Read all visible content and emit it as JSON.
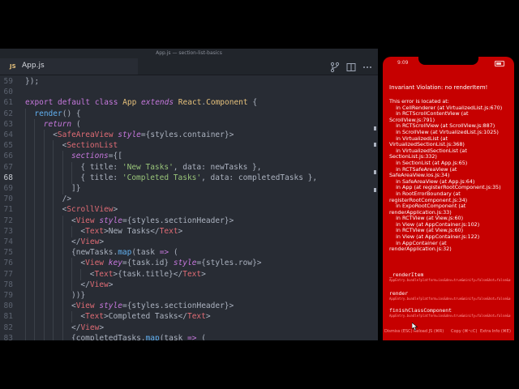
{
  "editor": {
    "window_title": "App.js — section-list-basics",
    "tab": {
      "lang_badge": "JS",
      "filename": "App.js"
    },
    "toolbar_icons": [
      "source-control-icon",
      "split-editor-icon",
      "more-actions-icon"
    ],
    "lines": [
      {
        "num": "59",
        "indent": 0,
        "tokens": [
          {
            "t": "});",
            "c": "br"
          }
        ]
      },
      {
        "num": "60",
        "indent": 0,
        "tokens": []
      },
      {
        "num": "61",
        "indent": 0,
        "tokens": [
          {
            "t": "export ",
            "c": "kw"
          },
          {
            "t": "default ",
            "c": "kw"
          },
          {
            "t": "class ",
            "c": "kw"
          },
          {
            "t": "App ",
            "c": "cls"
          },
          {
            "t": "extends ",
            "c": "kw ital"
          },
          {
            "t": "React",
            "c": "cls"
          },
          {
            "t": ".",
            "c": "br"
          },
          {
            "t": "Component",
            "c": "cls"
          },
          {
            "t": " {",
            "c": "br"
          }
        ]
      },
      {
        "num": "62",
        "indent": 1,
        "tokens": [
          {
            "t": "render",
            "c": "fn"
          },
          {
            "t": "() {",
            "c": "br"
          }
        ]
      },
      {
        "num": "63",
        "indent": 2,
        "tokens": [
          {
            "t": "return",
            "c": "kw ital"
          },
          {
            "t": " (",
            "c": "br"
          }
        ]
      },
      {
        "num": "64",
        "indent": 3,
        "tokens": [
          {
            "t": "<",
            "c": "br"
          },
          {
            "t": "SafeAreaView",
            "c": "tag"
          },
          {
            "t": " ",
            "c": "br"
          },
          {
            "t": "style",
            "c": "attr ital"
          },
          {
            "t": "={styles.container}>",
            "c": "br"
          }
        ]
      },
      {
        "num": "65",
        "indent": 4,
        "tokens": [
          {
            "t": "<",
            "c": "br"
          },
          {
            "t": "SectionList",
            "c": "tag"
          }
        ]
      },
      {
        "num": "66",
        "indent": 5,
        "tokens": [
          {
            "t": "sections",
            "c": "attr ital"
          },
          {
            "t": "={[",
            "c": "br"
          }
        ]
      },
      {
        "num": "67",
        "indent": 6,
        "tokens": [
          {
            "t": "{ title: ",
            "c": "prop"
          },
          {
            "t": "'New Tasks'",
            "c": "str"
          },
          {
            "t": ", data: newTasks },",
            "c": "prop"
          }
        ]
      },
      {
        "num": "68",
        "indent": 6,
        "active": true,
        "tokens": [
          {
            "t": "{ title: ",
            "c": "prop"
          },
          {
            "t": "'Completed Tasks'",
            "c": "str"
          },
          {
            "t": ", data: completedTasks },",
            "c": "prop"
          }
        ]
      },
      {
        "num": "69",
        "indent": 5,
        "tokens": [
          {
            "t": "]}",
            "c": "br"
          }
        ]
      },
      {
        "num": "70",
        "indent": 4,
        "tokens": [
          {
            "t": "/>",
            "c": "br"
          }
        ]
      },
      {
        "num": "71",
        "indent": 4,
        "tokens": [
          {
            "t": "<",
            "c": "br"
          },
          {
            "t": "ScrollView",
            "c": "tag"
          },
          {
            "t": ">",
            "c": "br"
          }
        ]
      },
      {
        "num": "72",
        "indent": 5,
        "tokens": [
          {
            "t": "<",
            "c": "br"
          },
          {
            "t": "View",
            "c": "tag"
          },
          {
            "t": " ",
            "c": "br"
          },
          {
            "t": "style",
            "c": "attr ital"
          },
          {
            "t": "={styles.sectionHeader}>",
            "c": "br"
          }
        ]
      },
      {
        "num": "73",
        "indent": 6,
        "tokens": [
          {
            "t": "<",
            "c": "br"
          },
          {
            "t": "Text",
            "c": "tag"
          },
          {
            "t": ">New Tasks</",
            "c": "br"
          },
          {
            "t": "Text",
            "c": "tag"
          },
          {
            "t": ">",
            "c": "br"
          }
        ]
      },
      {
        "num": "74",
        "indent": 5,
        "tokens": [
          {
            "t": "</",
            "c": "br"
          },
          {
            "t": "View",
            "c": "tag"
          },
          {
            "t": ">",
            "c": "br"
          }
        ]
      },
      {
        "num": "75",
        "indent": 5,
        "tokens": [
          {
            "t": "{newTasks.",
            "c": "br"
          },
          {
            "t": "map",
            "c": "fn"
          },
          {
            "t": "(task ",
            "c": "br"
          },
          {
            "t": "=>",
            "c": "kw"
          },
          {
            "t": " (",
            "c": "br"
          }
        ]
      },
      {
        "num": "76",
        "indent": 6,
        "tokens": [
          {
            "t": "<",
            "c": "br"
          },
          {
            "t": "View",
            "c": "tag"
          },
          {
            "t": " ",
            "c": "br"
          },
          {
            "t": "key",
            "c": "attr ital"
          },
          {
            "t": "={task.id} ",
            "c": "br"
          },
          {
            "t": "style",
            "c": "attr ital"
          },
          {
            "t": "={styles.row}>",
            "c": "br"
          }
        ]
      },
      {
        "num": "77",
        "indent": 7,
        "tokens": [
          {
            "t": "<",
            "c": "br"
          },
          {
            "t": "Text",
            "c": "tag"
          },
          {
            "t": ">{task.title}</",
            "c": "br"
          },
          {
            "t": "Text",
            "c": "tag"
          },
          {
            "t": ">",
            "c": "br"
          }
        ]
      },
      {
        "num": "78",
        "indent": 6,
        "tokens": [
          {
            "t": "</",
            "c": "br"
          },
          {
            "t": "View",
            "c": "tag"
          },
          {
            "t": ">",
            "c": "br"
          }
        ]
      },
      {
        "num": "79",
        "indent": 5,
        "tokens": [
          {
            "t": "))}",
            "c": "br"
          }
        ]
      },
      {
        "num": "80",
        "indent": 5,
        "tokens": [
          {
            "t": "<",
            "c": "br"
          },
          {
            "t": "View",
            "c": "tag"
          },
          {
            "t": " ",
            "c": "br"
          },
          {
            "t": "style",
            "c": "attr ital"
          },
          {
            "t": "={styles.sectionHeader}>",
            "c": "br"
          }
        ]
      },
      {
        "num": "81",
        "indent": 6,
        "tokens": [
          {
            "t": "<",
            "c": "br"
          },
          {
            "t": "Text",
            "c": "tag"
          },
          {
            "t": ">Completed Tasks</",
            "c": "br"
          },
          {
            "t": "Text",
            "c": "tag"
          },
          {
            "t": ">",
            "c": "br"
          }
        ]
      },
      {
        "num": "82",
        "indent": 5,
        "tokens": [
          {
            "t": "</",
            "c": "br"
          },
          {
            "t": "View",
            "c": "tag"
          },
          {
            "t": ">",
            "c": "br"
          }
        ]
      },
      {
        "num": "83",
        "indent": 5,
        "tokens": [
          {
            "t": "{completedTasks.",
            "c": "br"
          },
          {
            "t": "map",
            "c": "fn"
          },
          {
            "t": "(task ",
            "c": "br"
          },
          {
            "t": "=>",
            "c": "kw"
          },
          {
            "t": " (",
            "c": "br"
          }
        ]
      }
    ]
  },
  "simulator": {
    "clock": "9:09",
    "error_title": "Invariant Violation: no renderItem!",
    "error_body": [
      "This error is located at:",
      "    in CellRenderer (at VirtualizedList.js:670)",
      "    in RCTScrollContentView (at",
      "ScrollView.js:791)",
      "    in RCTScrollView (at ScrollView.js:887)",
      "    in ScrollView (at VirtualizedList.js:1025)",
      "    in VirtualizedList (at",
      "VirtualizedSectionList.js:368)",
      "    in VirtualizedSectionList (at",
      "SectionList.js:332)",
      "    in SectionList (at App.js:65)",
      "    in RCTSafeAreaView (at",
      "SafeAreaView.ios.js:34)",
      "    in SafeAreaView (at App.js:64)",
      "    in App (at registerRootComponent.js:35)",
      "    in RootErrorBoundary (at",
      "registerRootComponent.js:34)",
      "    in ExpoRootComponent (at",
      "renderApplication.js:33)",
      "    in RCTView (at View.js:60)",
      "    in View (at AppContainer.js:102)",
      "    in RCTView (at View.js:60)",
      "    in View (at AppContainer.js:122)",
      "    in AppContainer (at",
      "renderApplication.js:32)"
    ],
    "stack_frames": [
      {
        "name": "_renderItem",
        "location": "AppEntry.bundle?platform=ios&dev=true&minify=false&hot=false&assetPlugin=..%2Fnode_modules%2Fexpo%2Ftools%2FhashAssetFiles:56637:28"
      },
      {
        "name": "render",
        "location": "AppEntry.bundle?platform=ios&dev=true&minify=false&hot=false&assetPlugin=..%2Fnode_modules%2Fexpo%2Ftools%2FhashAssetFiles:45696:33"
      },
      {
        "name": "finishClassComponent",
        "location": "AppEntry.bundle?platform=ios&dev=true&minify=false&hot=false&assetPlugin=..%2Fnode_modules%2Fexpo%2Ftools%2FhashAssetFiles:18660:45"
      }
    ],
    "footer_buttons": {
      "dismiss": "Dismiss (ESC)",
      "reload": "Reload JS (⌘R)",
      "copy": "Copy (⌘⌥C)",
      "extra": "Extra Info (⌘E)"
    },
    "colors": {
      "error_bg": "#c60000"
    }
  }
}
